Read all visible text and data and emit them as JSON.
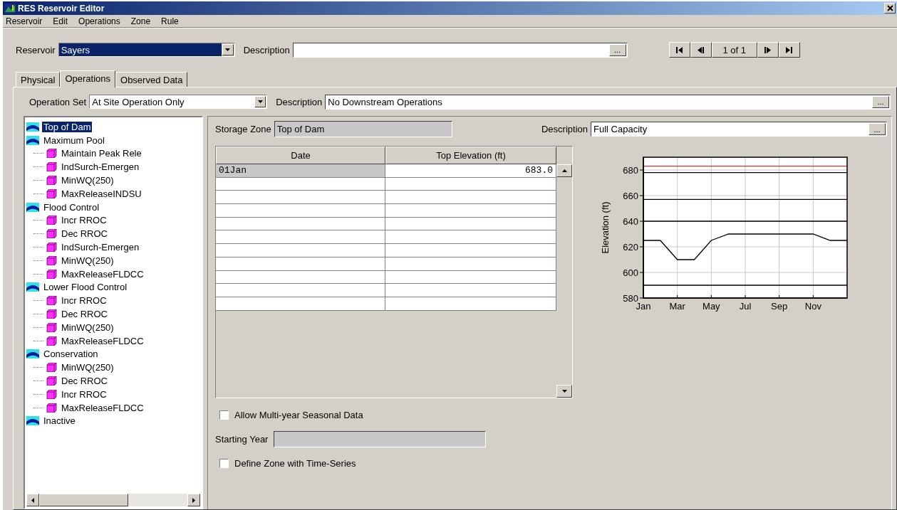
{
  "window": {
    "title": "RES Reservoir Editor"
  },
  "menu": [
    "Reservoir",
    "Edit",
    "Operations",
    "Zone",
    "Rule"
  ],
  "reservoir": {
    "label": "Reservoir",
    "value": "Sayers",
    "description_label": "Description",
    "button": "...",
    "record": "1 of 1"
  },
  "tabs": [
    {
      "label": "Physical",
      "selected": false
    },
    {
      "label": "Operations",
      "selected": true
    },
    {
      "label": "Observed Data",
      "selected": false
    }
  ],
  "operation_set": {
    "label": "Operation Set",
    "value": "At Site Operation Only",
    "description_label": "Description",
    "description": "No Downstream Operations",
    "button": "..."
  },
  "zones": [
    {
      "label": "Top of Dam",
      "selected": true
    },
    {
      "label": "Maximum Pool",
      "selected": false,
      "children": [
        {
          "label": "Maintain Peak Rele",
          "selected": false
        },
        {
          "label": "IndSurch-Emergen",
          "selected": false
        },
        {
          "label": "MinWQ(250)",
          "selected": false
        },
        {
          "label": "MaxReleaseINDSU",
          "selected": false
        }
      ]
    },
    {
      "label": "Flood Control",
      "selected": false,
      "children": [
        {
          "label": "Incr RROC",
          "selected": false
        },
        {
          "label": "Dec RROC",
          "selected": false
        },
        {
          "label": "IndSurch-Emergen",
          "selected": false
        },
        {
          "label": "MinWQ(250)",
          "selected": false
        },
        {
          "label": "MaxReleaseFLDCC",
          "selected": false
        }
      ]
    },
    {
      "label": "Lower Flood Control",
      "selected": false,
      "children": [
        {
          "label": "Incr RROC",
          "selected": false
        },
        {
          "label": "Dec RROC",
          "selected": false
        },
        {
          "label": "MinWQ(250)",
          "selected": false
        },
        {
          "label": "MaxReleaseFLDCC",
          "selected": false
        }
      ]
    },
    {
      "label": "Conservation",
      "selected": false,
      "children": [
        {
          "label": "MinWQ(250)",
          "selected": false
        },
        {
          "label": "Dec RROC",
          "selected": false
        },
        {
          "label": "Incr RROC",
          "selected": false
        },
        {
          "label": "MaxReleaseFLDCC",
          "selected": false
        }
      ]
    },
    {
      "label": "Inactive",
      "selected": false
    }
  ],
  "storage_zone": {
    "label": "Storage Zone",
    "value": "Top of Dam",
    "description_label": "Description",
    "description": "Full Capacity",
    "button": "..."
  },
  "table": {
    "columns": [
      "Date",
      "Top Elevation (ft)"
    ],
    "rows": [
      {
        "cells": [
          "01Jan",
          "683.0"
        ],
        "selected": true
      }
    ]
  },
  "chart_data": {
    "type": "line",
    "grid": true,
    "ylabel": "Elevation (ft)",
    "categories": [
      "Jan",
      null,
      "Mar",
      null,
      "May",
      null,
      "Jul",
      null,
      "Sep",
      null,
      "Nov",
      null,
      null
    ],
    "ylim": [
      580,
      690
    ],
    "yticks": [
      580,
      600,
      620,
      640,
      660,
      680
    ],
    "series": [
      {
        "color": "#e03030",
        "values": [
          683,
          683,
          683,
          683,
          683,
          683,
          683,
          683,
          683,
          683,
          683,
          683,
          683
        ]
      },
      {
        "color": "#000000",
        "values": [
          678,
          678,
          678,
          678,
          678,
          678,
          678,
          678,
          678,
          678,
          678,
          678,
          678
        ]
      },
      {
        "color": "#000000",
        "values": [
          657,
          657,
          657,
          657,
          657,
          657,
          657,
          657,
          657,
          657,
          657,
          657,
          657
        ]
      },
      {
        "color": "#000000",
        "values": [
          640,
          640,
          640,
          640,
          640,
          640,
          640,
          640,
          640,
          640,
          640,
          640,
          640
        ]
      },
      {
        "color": "#000000",
        "values": [
          625,
          625,
          610,
          610,
          625,
          630,
          630,
          630,
          630,
          630,
          630,
          625,
          625
        ]
      },
      {
        "color": "#000000",
        "values": [
          590,
          590,
          590,
          590,
          590,
          590,
          590,
          590,
          590,
          590,
          590,
          590,
          590
        ]
      }
    ]
  },
  "options": [
    {
      "kind": "checkbox",
      "label": "Allow Multi-year Seasonal Data",
      "checked": false
    },
    {
      "kind": "field",
      "label": "Starting Year",
      "disabled": true
    },
    {
      "kind": "checkbox",
      "label": "Define Zone with Time-Series",
      "checked": false
    }
  ]
}
